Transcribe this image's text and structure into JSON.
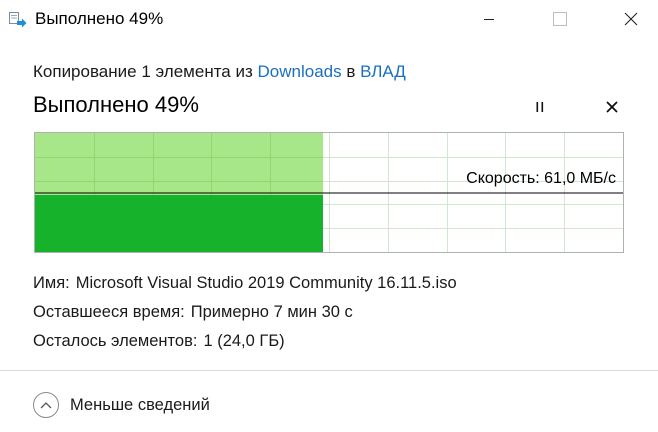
{
  "window": {
    "title": "Выполнено 49%",
    "icons": {
      "app": "copy-arrow-icon",
      "minimize": "minimize-icon",
      "maximize": "maximize-icon",
      "close": "close-icon"
    }
  },
  "operation": {
    "prefix": "Копирование 1 элемента из ",
    "source": "Downloads",
    "middle": " в ",
    "destination": "ВЛАД"
  },
  "progress": {
    "title": "Выполнено 49%",
    "percent": 49,
    "pause_icon": "pause-icon",
    "cancel_icon": "cancel-icon"
  },
  "graph": {
    "speed_label": "Скорость: 61,0 МБ/с",
    "colors": {
      "done_light": "#a8e68a",
      "done_dark": "#16b22b",
      "grid": "#cfe8cf",
      "line": "#000000"
    }
  },
  "details": {
    "name_label": "Имя:",
    "name_value": "Microsoft Visual Studio 2019 Community 16.11.5.iso",
    "remaining_label": "Оставшееся время:",
    "remaining_value": "Примерно 7 мин 30 с",
    "items_label": "Осталось элементов:",
    "items_value": "1 (24,0 ГБ)"
  },
  "footer": {
    "fewer_label": "Меньше сведений",
    "fewer_icon": "chevron-up-icon"
  }
}
